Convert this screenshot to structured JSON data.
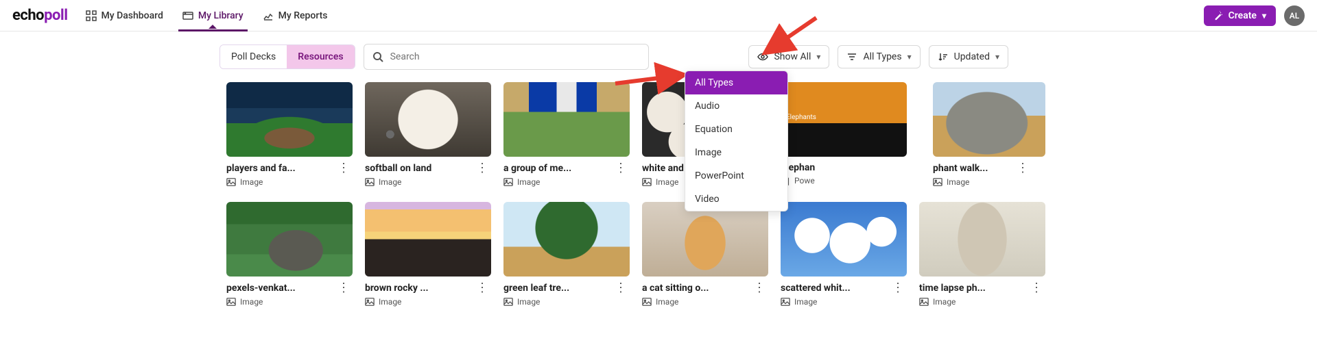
{
  "brand": {
    "part1": "echo",
    "part2": "poll"
  },
  "nav": {
    "dashboard": "My Dashboard",
    "library": "My Library",
    "reports": "My Reports"
  },
  "header": {
    "create_label": "Create",
    "avatar_initials": "AL"
  },
  "toolbar": {
    "tab_poll_decks": "Poll Decks",
    "tab_resources": "Resources",
    "search_placeholder": "Search",
    "show_all_label": "Show All",
    "all_types_label": "All Types",
    "updated_label": "Updated"
  },
  "type_filter": {
    "options": {
      "0": "All Types",
      "1": "Audio",
      "2": "Equation",
      "3": "Image",
      "4": "PowerPoint",
      "5": "Video"
    }
  },
  "type_labels": {
    "image": "Image",
    "power": "Powe",
    "powerpoint": "PowerPoint"
  },
  "cards": {
    "0": {
      "title": "players and fa...",
      "type": "Image"
    },
    "1": {
      "title": "softball on land",
      "type": "Image"
    },
    "2": {
      "title": "a group of me...",
      "type": "Image"
    },
    "3": {
      "title": "white and red ...",
      "type": "Image"
    },
    "4": {
      "title": "Elephan",
      "type": "Powe"
    },
    "5": {
      "title": "phant walk...",
      "type": "Image"
    },
    "6": {
      "title": "pexels-venkat...",
      "type": "Image"
    },
    "7": {
      "title": "brown rocky ...",
      "type": "Image"
    },
    "8": {
      "title": "green leaf tre...",
      "type": "Image"
    },
    "9": {
      "title": "a cat sitting o...",
      "type": "Image"
    },
    "10": {
      "title": "scattered whit...",
      "type": "Image"
    },
    "11": {
      "title": "time lapse ph...",
      "type": "Image"
    }
  },
  "slide_text": "Elephants"
}
